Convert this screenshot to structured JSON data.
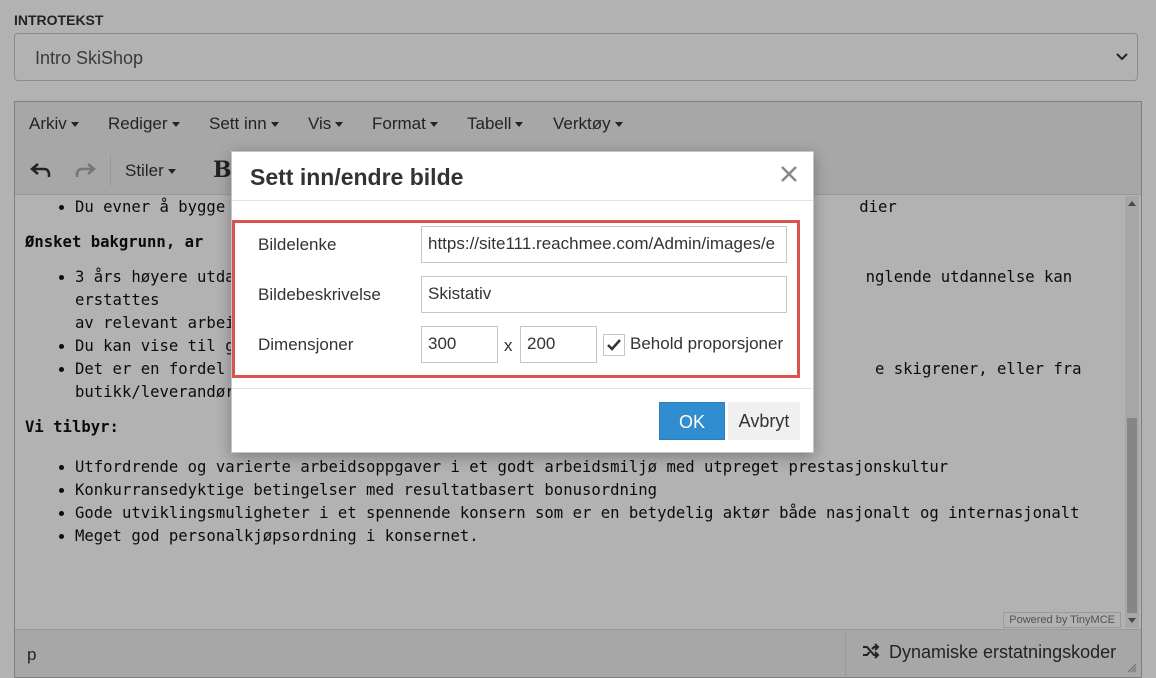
{
  "intro": {
    "label": "INTROTEKST",
    "selected": "Intro SkiShop"
  },
  "menubar": [
    "Arkiv",
    "Rediger",
    "Sett inn",
    "Vis",
    "Format",
    "Tabell",
    "Verktøy"
  ],
  "toolbar": {
    "styles": "Stiler",
    "bold": "B"
  },
  "content": {
    "bullet_first": "Du evner å bygge",
    "bullet_first_end": "dier",
    "heading_bakgrunn": "Ønsket bakgrunn, ar",
    "bakgrunn_items": [
      "3 års høyere utda",
      "av relevant arbei",
      "Du kan vise til go",
      "Det er en fordel o",
      "butikk/leverandør"
    ],
    "bakgrunn_tails": [
      "nglende utdannelse kan erstattes",
      "e skigrener, eller fra"
    ],
    "heading_tilbyr": "Vi tilbyr:",
    "tilbyr_items": [
      "Utfordrende og varierte arbeidsoppgaver i et godt arbeidsmiljø med utpreget prestasjonskultur",
      "Konkurransedyktige betingelser med resultatbasert bonusordning",
      "Gode utviklingsmuligheter i et spennende konsern som er en betydelig aktør både nasjonalt og internasjonalt",
      "Meget god personalkjøpsordning i konsernet."
    ]
  },
  "powered_by": "Powered by TinyMCE",
  "statusbar": {
    "path": "p",
    "dynamic": "Dynamiske erstatningskoder"
  },
  "dialog": {
    "title": "Sett inn/endre bilde",
    "fields": {
      "link_label": "Bildelenke",
      "link_value": "https://site111.reachmee.com/Admin/images/e",
      "desc_label": "Bildebeskrivelse",
      "desc_value": "Skistativ",
      "dim_label": "Dimensjoner",
      "width": "300",
      "x": "x",
      "height": "200",
      "keep_label": "Behold proporsjoner",
      "keep_checked": true
    },
    "ok": "OK",
    "cancel": "Avbryt"
  },
  "colors": {
    "primary_button": "#2f8dd0",
    "highlight_border": "#d9534f"
  }
}
